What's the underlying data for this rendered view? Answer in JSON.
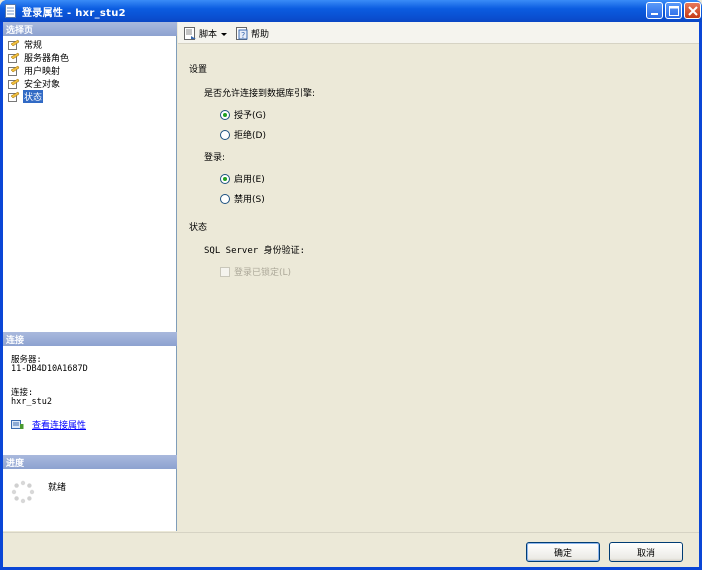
{
  "window": {
    "title": "登录属性 - hxr_stu2"
  },
  "left": {
    "select_page_header": "选择页",
    "pages": [
      {
        "label": "常规",
        "icon": "page-icon",
        "selected": false
      },
      {
        "label": "服务器角色",
        "icon": "page-icon",
        "selected": false
      },
      {
        "label": "用户映射",
        "icon": "page-icon",
        "selected": false
      },
      {
        "label": "安全对象",
        "icon": "page-icon",
        "selected": false
      },
      {
        "label": "状态",
        "icon": "page-icon",
        "selected": true
      }
    ],
    "connection_header": "连接",
    "server_label": "服务器:",
    "server_value": "11-DB4D10A1687D",
    "connection_label": "连接:",
    "connection_value": "hxr_stu2",
    "view_connection_link": "查看连接属性",
    "progress_header": "进度",
    "progress_status": "就绪"
  },
  "toolbar": {
    "script_label": "脚本",
    "help_label": "帮助"
  },
  "content": {
    "settings_header": "设置",
    "permission_question": "是否允许连接到数据库引擎:",
    "grant_label": "授予(G)",
    "deny_label": "拒绝(D)",
    "login_label": "登录:",
    "enabled_label": "启用(E)",
    "disabled_label": "禁用(S)",
    "status_header": "状态",
    "sql_auth_label": "SQL Server 身份验证:",
    "login_locked_label": "登录已锁定(L)",
    "selected_permission": "grant",
    "selected_login": "enabled",
    "login_locked": false
  },
  "footer": {
    "ok_label": "确定",
    "cancel_label": "取消"
  },
  "colors": {
    "title_bar": "#0a4fd0",
    "section_header": "#8da2d0",
    "selection": "#316ac5",
    "link": "#0000ff"
  }
}
